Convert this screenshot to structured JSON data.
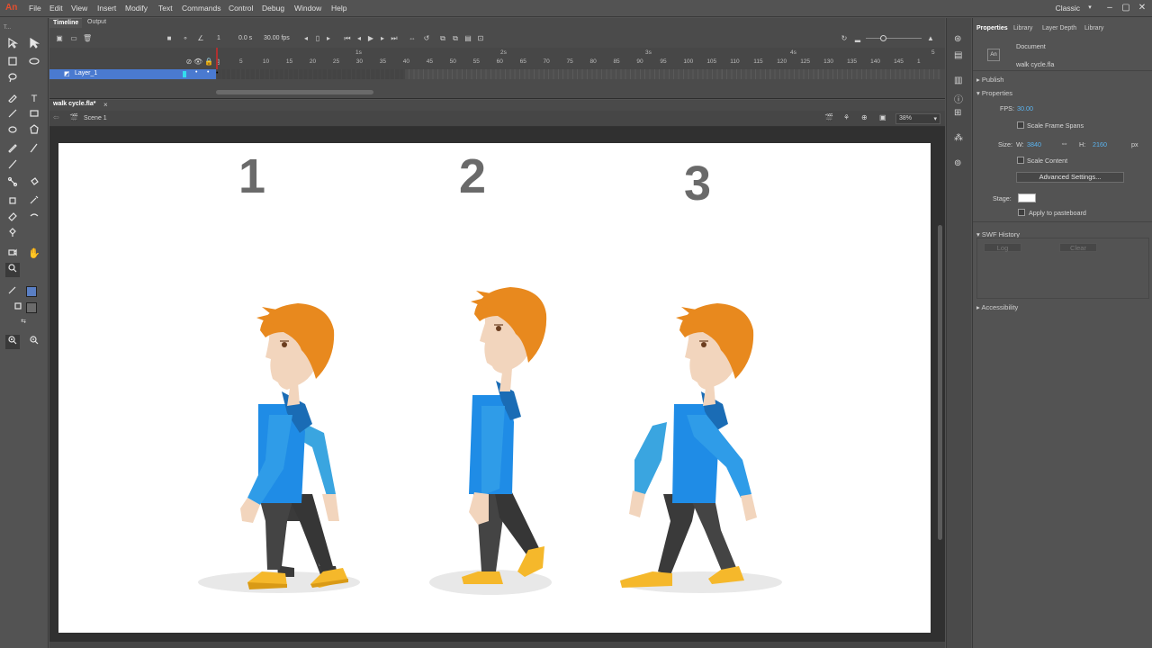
{
  "app": {
    "logo": "An"
  },
  "menu": [
    "File",
    "Edit",
    "View",
    "Insert",
    "Modify",
    "Text",
    "Commands",
    "Control",
    "Debug",
    "Window",
    "Help"
  ],
  "workspace": "Classic",
  "timeline": {
    "tabs": [
      "Timeline",
      "Output"
    ],
    "current_frame": "1",
    "time": "0.0 s",
    "fps": "30.00 fps",
    "layer_name": "Layer_1",
    "seconds": [
      "1s",
      "2s",
      "3s",
      "4s",
      "5"
    ],
    "frame_ticks": [
      "1",
      "5",
      "10",
      "15",
      "20",
      "25",
      "30",
      "35",
      "40",
      "45",
      "50",
      "55",
      "60",
      "65",
      "70",
      "75",
      "80",
      "85",
      "90",
      "95",
      "100",
      "105",
      "110",
      "115",
      "120",
      "125",
      "130",
      "135",
      "140",
      "145",
      "1"
    ]
  },
  "document_tab": {
    "name": "walk cycle.fla*",
    "close": "×"
  },
  "scene": {
    "name": "Scene 1",
    "zoom": "38%"
  },
  "stage": {
    "labels": [
      "1",
      "2",
      "3"
    ]
  },
  "properties": {
    "tabs": [
      "Properties",
      "Library",
      "Layer Depth",
      "Library"
    ],
    "doc_type": "Document",
    "doc_name": "walk cycle.fla",
    "publish": "Publish",
    "properties": "Properties",
    "fps_label": "FPS:",
    "fps_value": "30.00",
    "scale_frame_spans": "Scale Frame Spans",
    "size_label": "Size:",
    "w_label": "W:",
    "w_value": "3840",
    "h_label": "H:",
    "h_value": "2160",
    "unit": "px",
    "scale_content": "Scale Content",
    "advanced_settings": "Advanced Settings...",
    "stage_label": "Stage:",
    "stage_color": "#ffffff",
    "apply_pasteboard": "Apply to pasteboard",
    "swf_history": "SWF History",
    "log": "Log",
    "clear": "Clear",
    "accessibility": "Accessibility"
  }
}
